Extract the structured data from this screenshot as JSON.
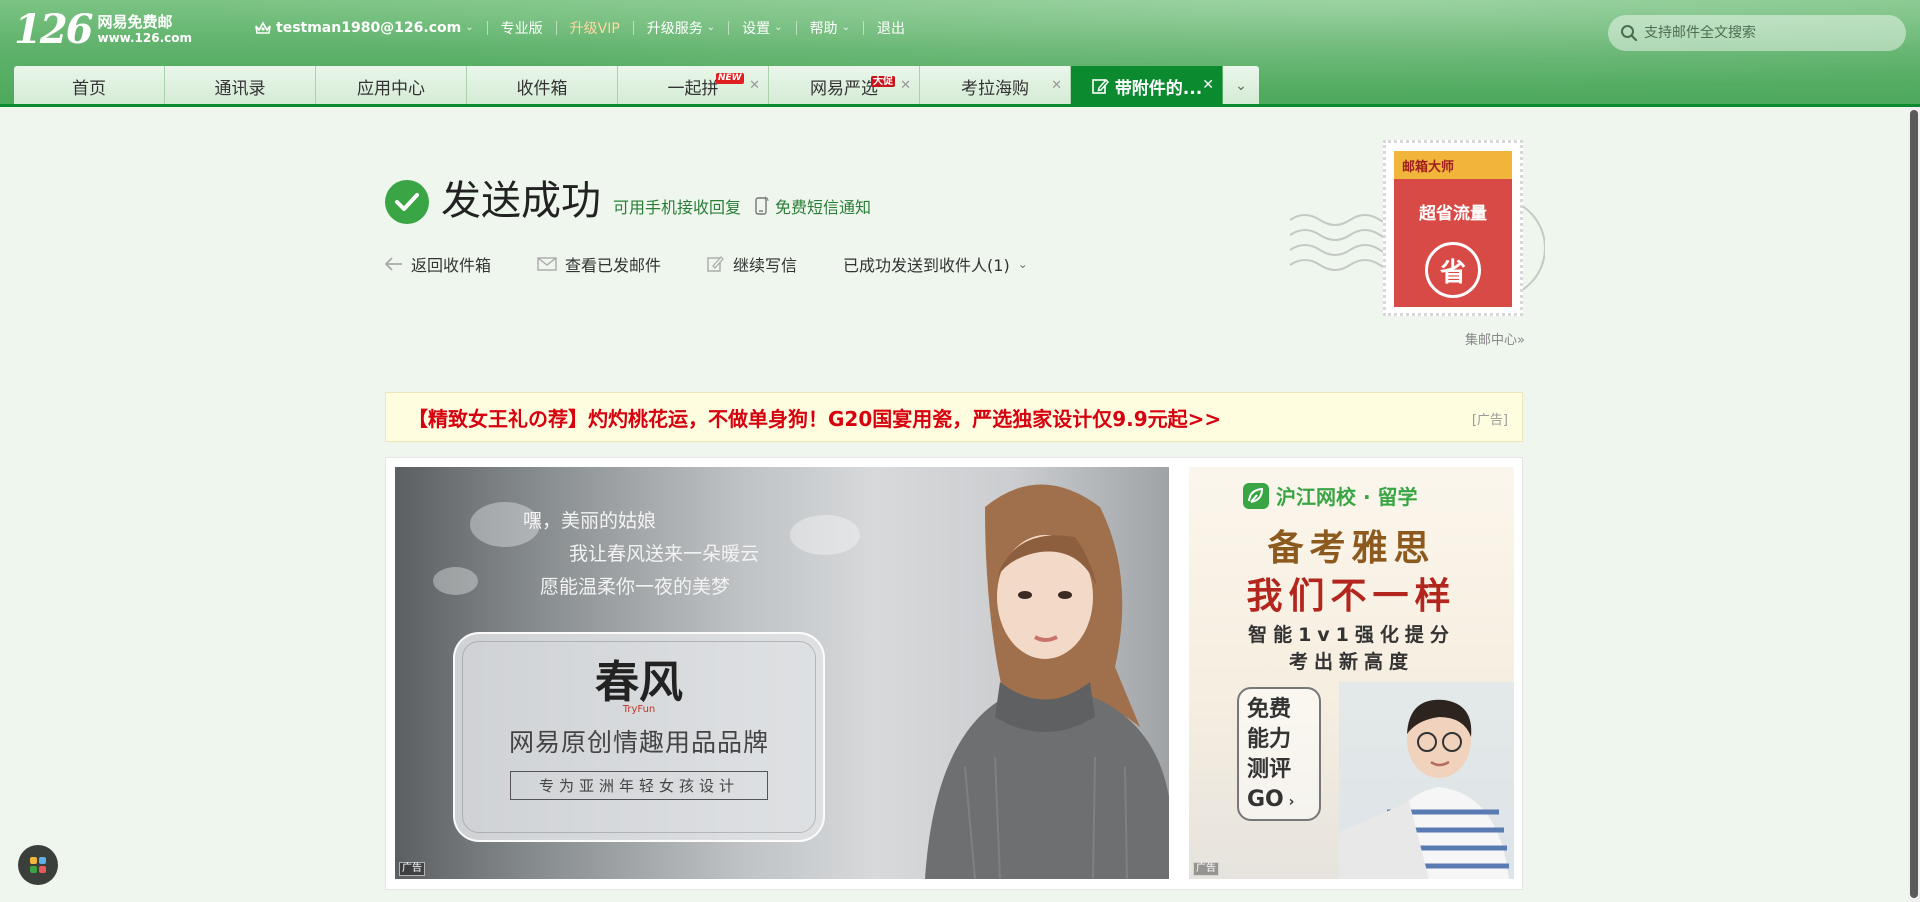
{
  "header": {
    "logo_number": "126",
    "logo_title": "网易免费邮",
    "logo_url": "www.126.com",
    "account": "testman1980@126.com",
    "links": {
      "pro": "专业版",
      "vip": "升级VIP",
      "upgrade": "升级服务",
      "settings": "设置",
      "help": "帮助",
      "logout": "退出"
    },
    "search_placeholder": "支持邮件全文搜索"
  },
  "tabs": [
    {
      "label": "首页"
    },
    {
      "label": "通讯录"
    },
    {
      "label": "应用中心"
    },
    {
      "label": "收件箱"
    },
    {
      "label": "一起拼",
      "badge": "NEW"
    },
    {
      "label": "网易严选",
      "badge": "大促"
    },
    {
      "label": "考拉海购"
    },
    {
      "label": "带附件的..."
    }
  ],
  "success": {
    "title": "发送成功",
    "mobile_reply": "可用手机接收回复",
    "sms_notice": "免费短信通知",
    "actions": {
      "back_inbox": "返回收件箱",
      "view_sent": "查看已发邮件",
      "continue_write": "继续写信",
      "sent_to": "已成功发送到收件人(1)"
    }
  },
  "stamp": {
    "brand": "邮箱大师",
    "slogan": "超省流量",
    "icon_char": "省",
    "link": "集邮中心»"
  },
  "adbar": {
    "text": "【精致女王礼の荐】灼灼桃花运，不做单身狗！G20国宴用瓷，严选独家设计仅9.9元起>>",
    "tag": "[广告]"
  },
  "banner_main": {
    "line1": "嘿，美丽的姑娘",
    "line2": "我让春风送来一朵暖云",
    "line3": "愿能温柔你一夜的美梦",
    "brand_logo": "春风",
    "brand_logo_en": "TryFun",
    "brand_desc": "网易原创情趣用品品牌",
    "brand_tag": "专为亚洲年轻女孩设计",
    "ad_label": "广告"
  },
  "banner_side": {
    "brand": "沪江网校 · 留学",
    "title1": "备考雅思",
    "title2": "我们不一样",
    "sub1": "智能1v1强化提分",
    "sub2": "考出新高度",
    "badge_l1": "免费",
    "badge_l2": "能力",
    "badge_l3": "测评",
    "badge_l4": "GO",
    "ad_label": "广告"
  },
  "colors": {
    "brand_green": "#0b8a2f",
    "success_green": "#3aa545",
    "ad_red": "#d7000f"
  }
}
